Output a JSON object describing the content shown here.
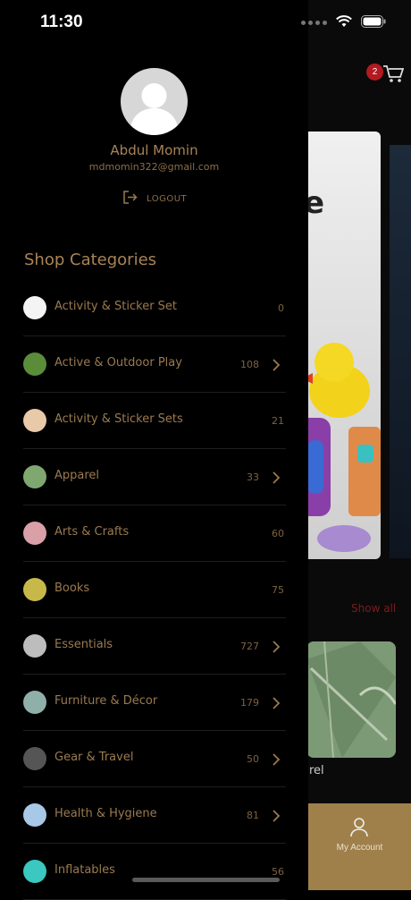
{
  "status_bar": {
    "time": "11:30"
  },
  "header": {
    "cart_badge": "2"
  },
  "background": {
    "banner_text": "e",
    "show_all": "Show all",
    "category_card_label": "rel",
    "bottom_tab": {
      "label": "My Account",
      "icon": "person-icon"
    }
  },
  "drawer": {
    "user": {
      "name": "Abdul Momin",
      "email": "mdmomin322@gmail.com"
    },
    "logout_label": "LOGOUT",
    "section_title": "Shop Categories",
    "categories": [
      {
        "label": "Activity & Sticker Set",
        "count": "0",
        "has_children": false,
        "thumb": "#f4f4f4"
      },
      {
        "label": "Active & Outdoor Play",
        "count": "108",
        "has_children": true,
        "thumb": "#5a8c3a"
      },
      {
        "label": "Activity & Sticker Sets",
        "count": "21",
        "has_children": false,
        "thumb": "#e8c9a8"
      },
      {
        "label": "Apparel",
        "count": "33",
        "has_children": true,
        "thumb": "#7fa870"
      },
      {
        "label": "Arts & Crafts",
        "count": "60",
        "has_children": false,
        "thumb": "#d9a0a8"
      },
      {
        "label": "Books",
        "count": "75",
        "has_children": false,
        "thumb": "#c8b84a"
      },
      {
        "label": "Essentials",
        "count": "727",
        "has_children": true,
        "thumb": "#bdbdbd"
      },
      {
        "label": "Furniture & Décor",
        "count": "179",
        "has_children": true,
        "thumb": "#8fb0a8"
      },
      {
        "label": "Gear & Travel",
        "count": "50",
        "has_children": true,
        "thumb": "#555555"
      },
      {
        "label": "Health & Hygiene",
        "count": "81",
        "has_children": true,
        "thumb": "#a8c8e8"
      },
      {
        "label": "Inflatables",
        "count": "56",
        "has_children": false,
        "thumb": "#3ac8c0"
      }
    ]
  }
}
